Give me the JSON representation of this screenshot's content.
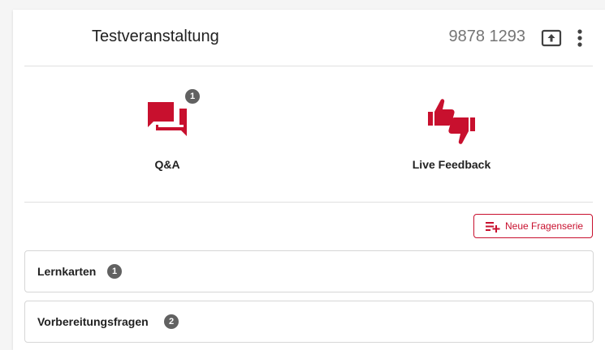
{
  "event": {
    "title": "Testveranstaltung",
    "room_code": "9878 1293",
    "share_icon": "present-to-all-icon",
    "menu_icon": "more-vert-icon"
  },
  "features": [
    {
      "label": "Q&A",
      "icon": "forum-icon",
      "badge": "1"
    },
    {
      "label": "Live Feedback",
      "icon": "thumbs-up-down-icon"
    }
  ],
  "actions": {
    "new_series_label": "Neue Fragenserie",
    "new_series_icon": "playlist-add-icon"
  },
  "series": [
    {
      "name": "Lernkarten",
      "count": "1"
    },
    {
      "name": "Vorbereitungsfragen",
      "count": "2"
    }
  ],
  "colors": {
    "accent": "#c8102e",
    "badge": "#616161",
    "text": "#212121",
    "muted": "#757575",
    "divider": "#e0e0e0"
  }
}
